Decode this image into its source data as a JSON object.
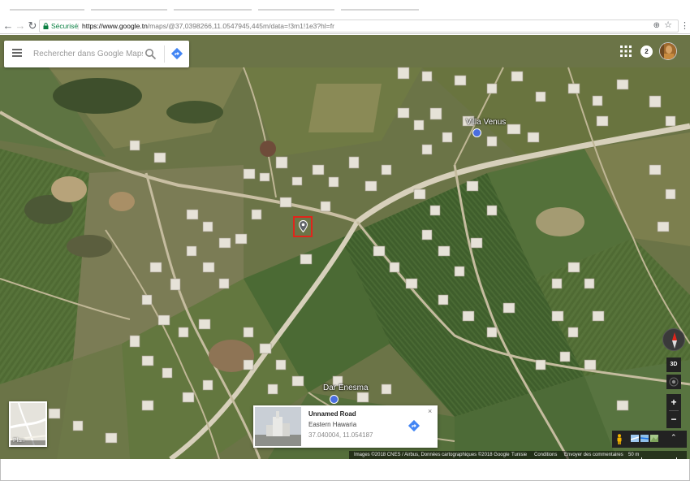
{
  "browser": {
    "secure_label": "Sécurisé",
    "url_separator": "|",
    "url_host": "https://www.google.tn",
    "url_path": "/maps/@37,0398266,11.0547945,445m/data=!3m1!1e3?hl=fr",
    "icons": [
      "back-icon",
      "forward-icon",
      "reload-icon",
      "lock-icon",
      "zoom-icon",
      "star-icon",
      "menu-icon"
    ]
  },
  "search": {
    "placeholder": "Rechercher dans Google Maps"
  },
  "header": {
    "notification_count": "2"
  },
  "places": [
    {
      "label": "Villa Venus"
    },
    {
      "label": "Dar Enesma"
    }
  ],
  "plan_thumb": {
    "label": "Plan"
  },
  "info_card": {
    "title": "Unnamed Road",
    "subtitle": "Eastern Hawaria",
    "coords": "37.040004, 11.054187",
    "close": "×"
  },
  "controls": {
    "btn_3d": "3D",
    "zoom_in": "+",
    "zoom_out": "−",
    "expand": "⌃"
  },
  "footer": {
    "attribution": "Images ©2018 CNES / Airbus, Données cartographiques ©2018 Google",
    "country": "Tunisie",
    "conditions": "Conditions",
    "feedback": "Envoyer des commentaires",
    "scale": "50 m"
  },
  "colors": {
    "secure_green": "#0b8043",
    "marker_red": "#e1251b",
    "google_blue": "#4285f4"
  }
}
